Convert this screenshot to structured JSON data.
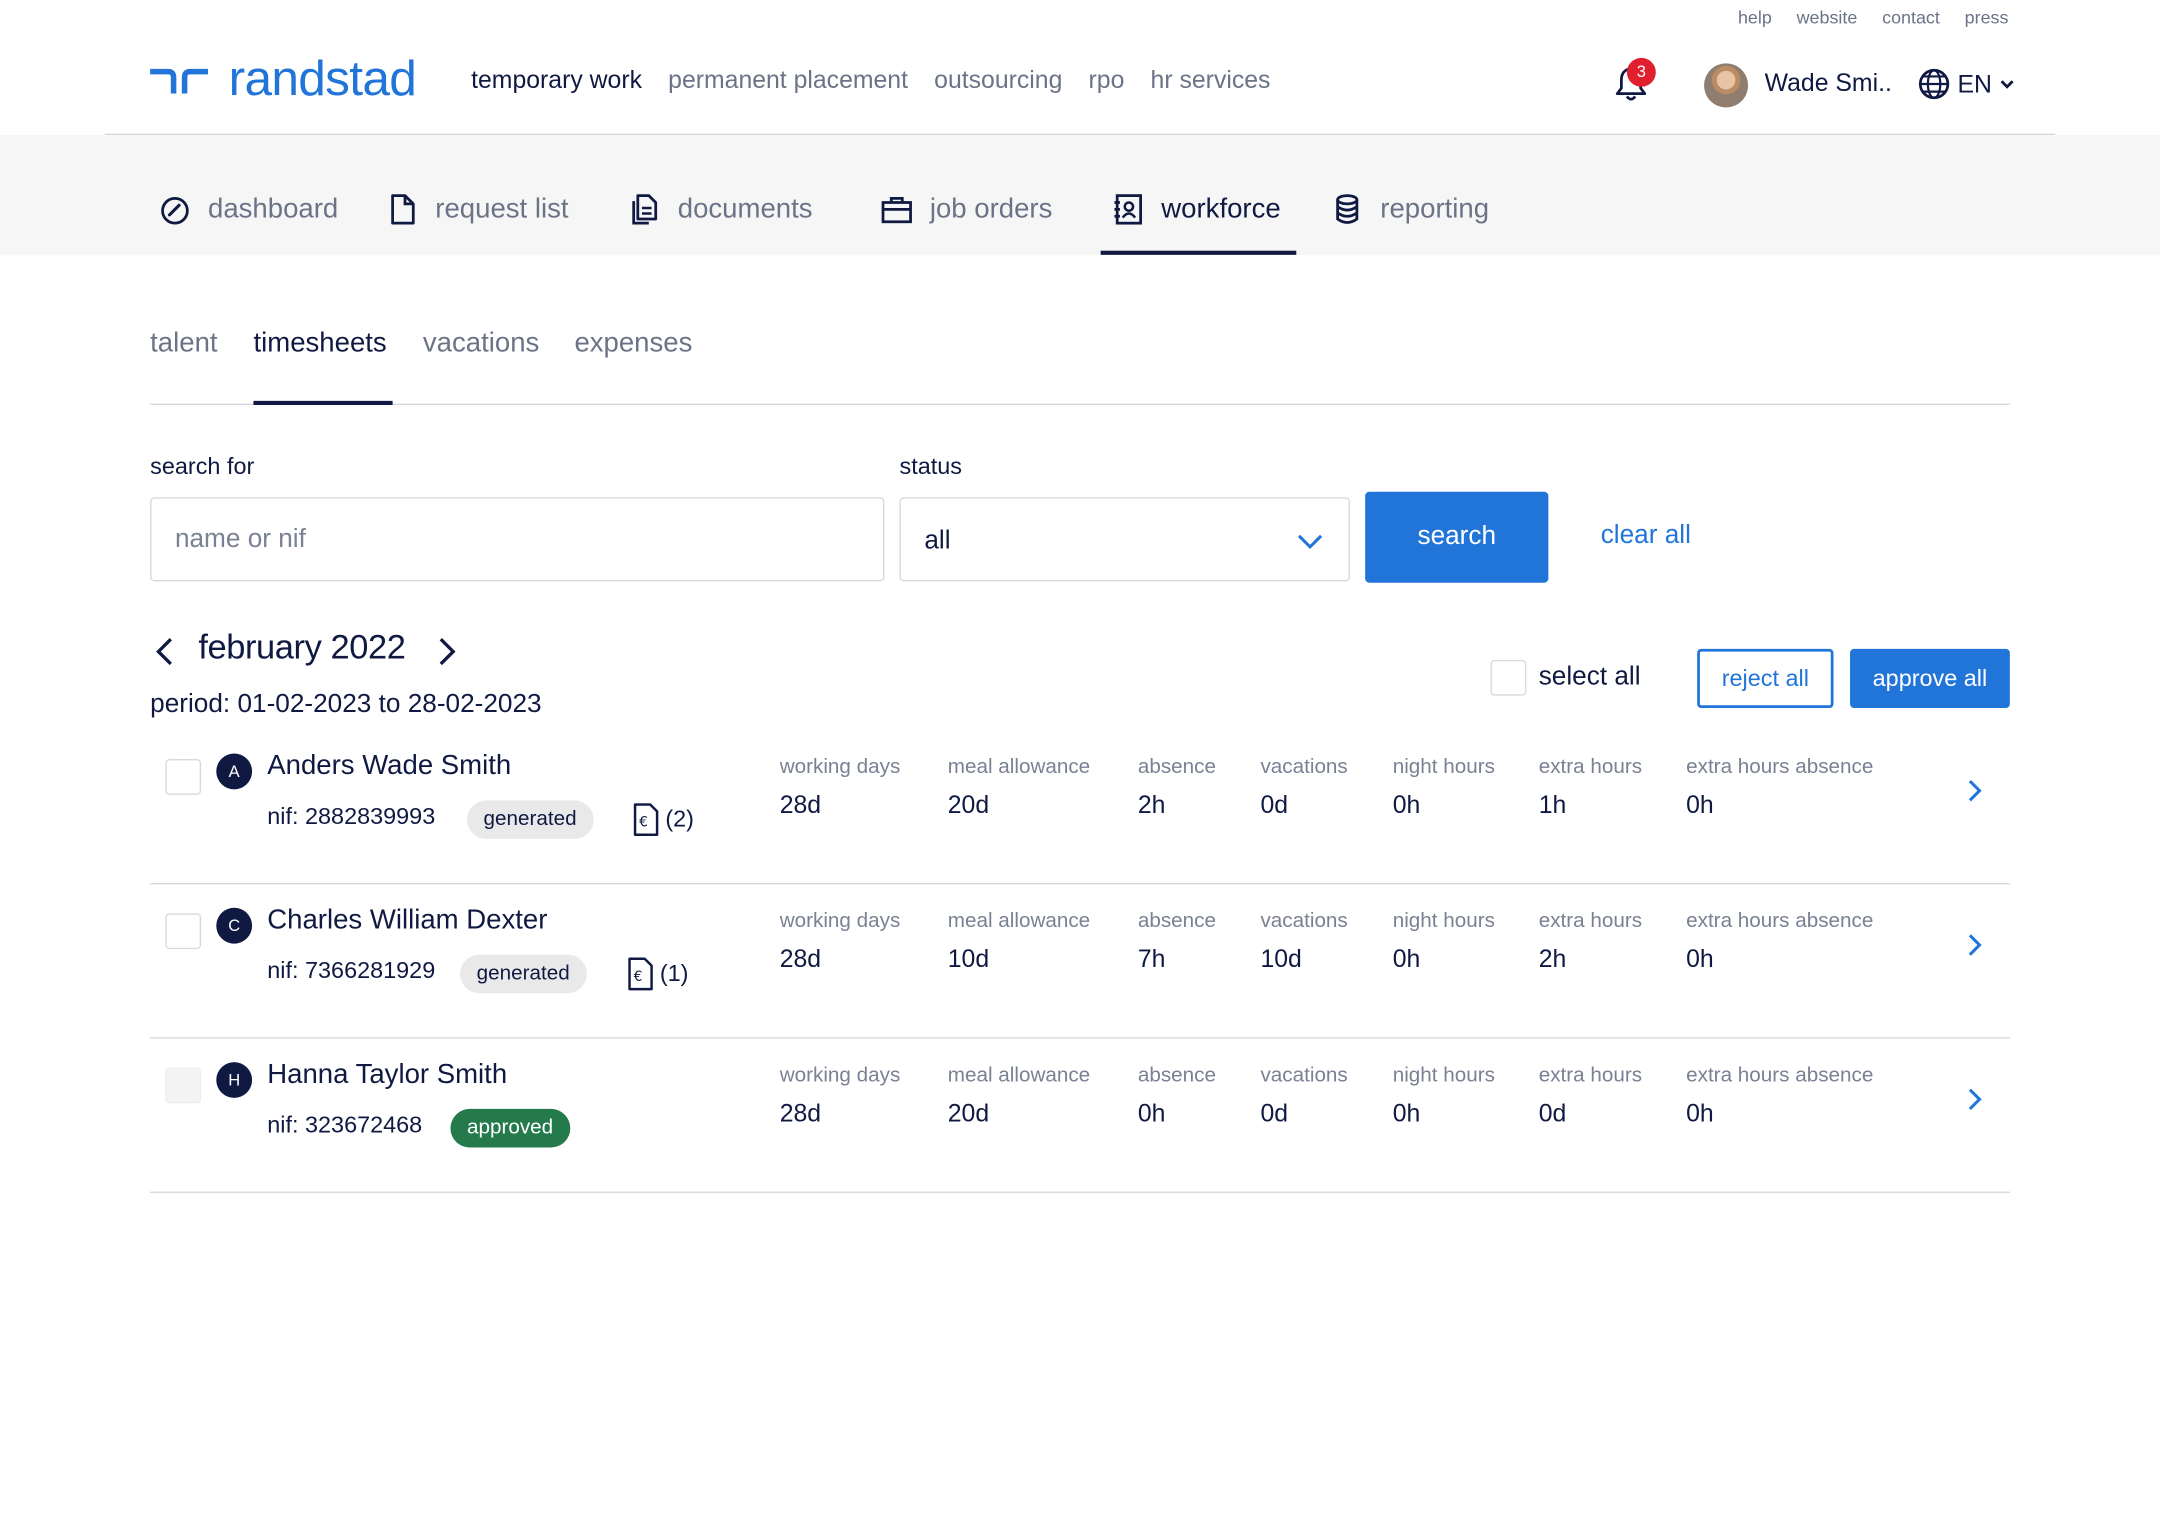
{
  "util_links": [
    "help",
    "website",
    "contact",
    "press"
  ],
  "brand": {
    "name": "randstad",
    "color": "#2175d9"
  },
  "main_nav": [
    "temporary work",
    "permanent placement",
    "outsourcing",
    "rpo",
    "hr services"
  ],
  "notifications": {
    "count": "3"
  },
  "user": {
    "name": "Wade Smi.."
  },
  "language": {
    "code": "EN"
  },
  "modules": [
    {
      "label": "dashboard",
      "icon": "dashboard-gauge-icon"
    },
    {
      "label": "request list",
      "icon": "file-icon"
    },
    {
      "label": "documents",
      "icon": "documents-icon"
    },
    {
      "label": "job orders",
      "icon": "briefcase-icon"
    },
    {
      "label": "workforce",
      "icon": "contact-book-icon",
      "active": true
    },
    {
      "label": "reporting",
      "icon": "database-icon"
    }
  ],
  "subtabs": [
    "talent",
    "timesheets",
    "vacations",
    "expenses"
  ],
  "active_subtab": "timesheets",
  "filters": {
    "search_label": "search for",
    "search_placeholder": "name or nif",
    "status_label": "status",
    "status_value": "all",
    "search_button": "search",
    "clear_link": "clear all"
  },
  "period": {
    "month": "february 2022",
    "range": "period: 01-02-2023 to 28-02-2023"
  },
  "bulk": {
    "select_all": "select all",
    "reject": "reject all",
    "approve": "approve all"
  },
  "stat_labels": [
    "working days",
    "meal allowance",
    "absence",
    "vacations",
    "night hours",
    "extra hours",
    "extra hours absence"
  ],
  "rows": [
    {
      "initial": "A",
      "name": "Anders Wade Smith",
      "nif": "nif: 2882839993",
      "status": "generated",
      "docs": "(2)",
      "values": [
        "28d",
        "20d",
        "2h",
        "0d",
        "0h",
        "1h",
        "0h"
      ]
    },
    {
      "initial": "C",
      "name": "Charles William Dexter",
      "nif": "nif: 7366281929",
      "status": "generated",
      "docs": "(1)",
      "values": [
        "28d",
        "10d",
        "7h",
        "10d",
        "0h",
        "2h",
        "0h"
      ]
    },
    {
      "initial": "H",
      "name": "Hanna Taylor Smith",
      "nif": "nif: 323672468",
      "status": "approved",
      "docs": "",
      "values": [
        "28d",
        "20d",
        "0h",
        "0d",
        "0h",
        "0d",
        "0h"
      ]
    }
  ],
  "colors": {
    "primary": "#2175d9",
    "navy": "#0f1941",
    "approved": "#257a4c",
    "alert": "#e0202e"
  }
}
